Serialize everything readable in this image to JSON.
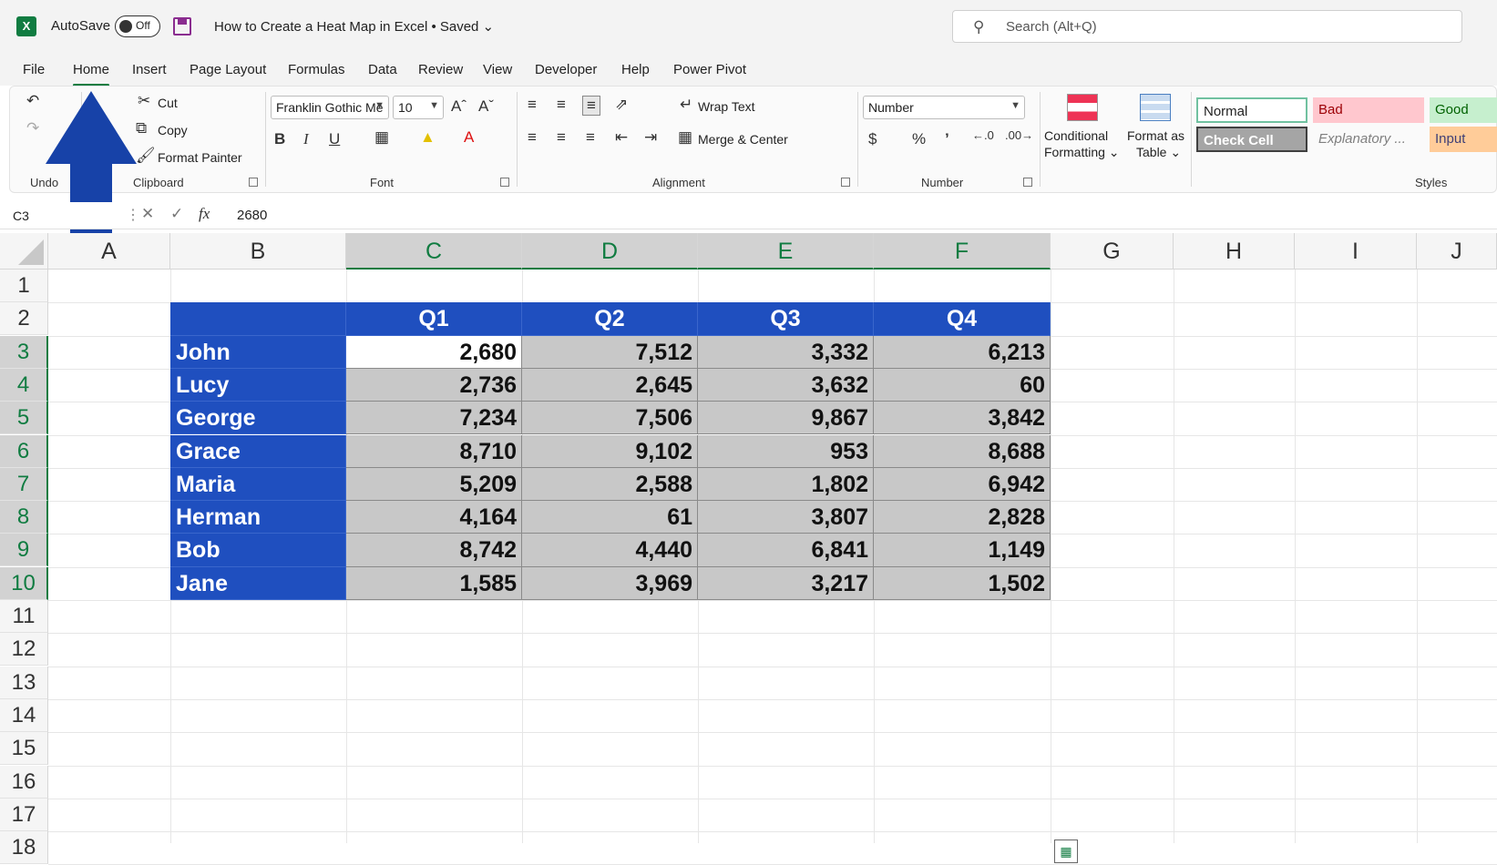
{
  "titlebar": {
    "app_icon": "X",
    "autosave_label": "AutoSave",
    "autosave_state": "Off",
    "document_title": "How to Create a Heat Map in Excel • Saved ⌄",
    "search_placeholder": "Search (Alt+Q)"
  },
  "tabs": [
    "File",
    "Home",
    "Insert",
    "Page Layout",
    "Formulas",
    "Data",
    "Review",
    "View",
    "Developer",
    "Help",
    "Power Pivot"
  ],
  "ribbon": {
    "undo_group": "Undo",
    "clipboard": {
      "cut": "Cut",
      "copy": "Copy",
      "format_painter": "Format Painter",
      "group": "Clipboard"
    },
    "font": {
      "name": "Franklin Gothic Me",
      "size": "10",
      "group": "Font"
    },
    "alignment": {
      "wrap": "Wrap Text",
      "merge": "Merge & Center",
      "group": "Alignment"
    },
    "number": {
      "format": "Number",
      "group": "Number"
    },
    "cond_format": {
      "line1": "Conditional",
      "line2": "Formatting ⌄"
    },
    "format_table": {
      "line1": "Format as",
      "line2": "Table ⌄"
    },
    "styles": {
      "normal": "Normal",
      "bad": "Bad",
      "good": "Good",
      "check": "Check Cell",
      "explanatory": "Explanatory ...",
      "input": "Input",
      "group": "Styles"
    }
  },
  "formula_bar": {
    "name_box": "C3",
    "fx": "fx",
    "value": "2680"
  },
  "columns": [
    "A",
    "B",
    "C",
    "D",
    "E",
    "F",
    "G",
    "H",
    "I",
    "J"
  ],
  "rows": [
    "1",
    "2",
    "3",
    "4",
    "5",
    "6",
    "7",
    "8",
    "9",
    "10",
    "11",
    "12",
    "13",
    "14",
    "15",
    "16",
    "17",
    "18"
  ],
  "table": {
    "headers": [
      "Q1",
      "Q2",
      "Q3",
      "Q4"
    ],
    "rows": [
      {
        "name": "John",
        "values": [
          "2,680",
          "7,512",
          "3,332",
          "6,213"
        ]
      },
      {
        "name": "Lucy",
        "values": [
          "2,736",
          "2,645",
          "3,632",
          "60"
        ]
      },
      {
        "name": "George",
        "values": [
          "7,234",
          "7,506",
          "9,867",
          "3,842"
        ]
      },
      {
        "name": "Grace",
        "values": [
          "8,710",
          "9,102",
          "953",
          "8,688"
        ]
      },
      {
        "name": "Maria",
        "values": [
          "5,209",
          "2,588",
          "1,802",
          "6,942"
        ]
      },
      {
        "name": "Herman",
        "values": [
          "4,164",
          "61",
          "3,807",
          "2,828"
        ]
      },
      {
        "name": "Bob",
        "values": [
          "8,742",
          "4,440",
          "6,841",
          "1,149"
        ]
      },
      {
        "name": "Jane",
        "values": [
          "1,585",
          "3,969",
          "3,217",
          "1,502"
        ]
      }
    ]
  },
  "colors": {
    "accent": "#107c41",
    "table_header": "#1f4fbf",
    "selection": "#c8c8c8",
    "arrow": "#1742a8"
  }
}
